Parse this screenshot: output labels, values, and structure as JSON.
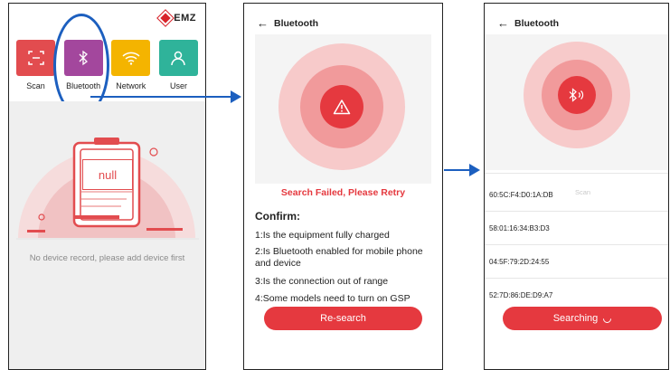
{
  "screen1": {
    "brand": "EMZ",
    "tiles": [
      {
        "label": "Scan",
        "color": "#e24c4f"
      },
      {
        "label": "Bluetooth",
        "color": "#a3479d"
      },
      {
        "label": "Network",
        "color": "#f4b400"
      },
      {
        "label": "User",
        "color": "#2fb39a"
      }
    ],
    "device_card_text": "null",
    "empty_message": "No device record, please add device first"
  },
  "screen2": {
    "title": "Bluetooth",
    "status": "Search Failed, Please Retry",
    "confirm_heading": "Confirm:",
    "tips": [
      "1:Is the equipment fully charged",
      "2:Is Bluetooth enabled for mobile phone and device",
      "3:Is the connection out of range",
      "4:Some models need to turn on GSP"
    ],
    "button": "Re-search"
  },
  "screen3": {
    "title": "Bluetooth",
    "scan_label": "Scan",
    "devices": [
      "60:5C:F4:D0:1A:DB",
      "58:01:16:34:B3:D3",
      "04:5F:79:2D:24:55",
      "52:7D:86:DE:D9:A7"
    ],
    "button": "Searching"
  },
  "colors": {
    "accent_red": "#e5393f",
    "arrow_blue": "#1c5fbf"
  }
}
